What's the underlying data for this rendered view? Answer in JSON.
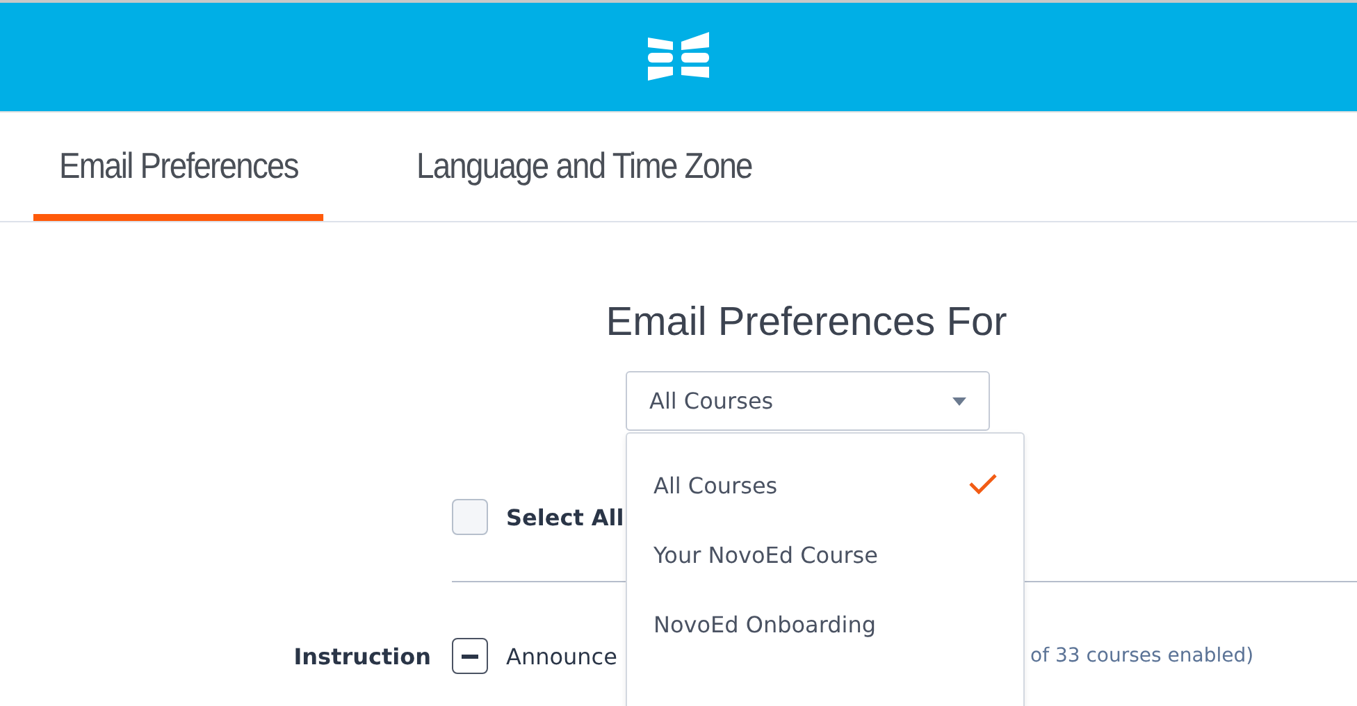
{
  "tabs": [
    {
      "label": "Email Preferences",
      "selected": true
    },
    {
      "label": "Language and Time Zone",
      "selected": false
    }
  ],
  "title": "Email Preferences For",
  "course_select": {
    "value": "All Courses",
    "options": [
      {
        "label": "All Courses",
        "selected": true
      },
      {
        "label": "Your NovoEd Course",
        "selected": false
      },
      {
        "label": "NovoEd Onboarding",
        "selected": false
      }
    ]
  },
  "select_all": {
    "label": "Select All",
    "checked": false,
    "partial": false
  },
  "categories": [
    {
      "label": "Instruction",
      "partial": true,
      "name": "Announce",
      "count": "of 33 courses enabled)"
    }
  ]
}
